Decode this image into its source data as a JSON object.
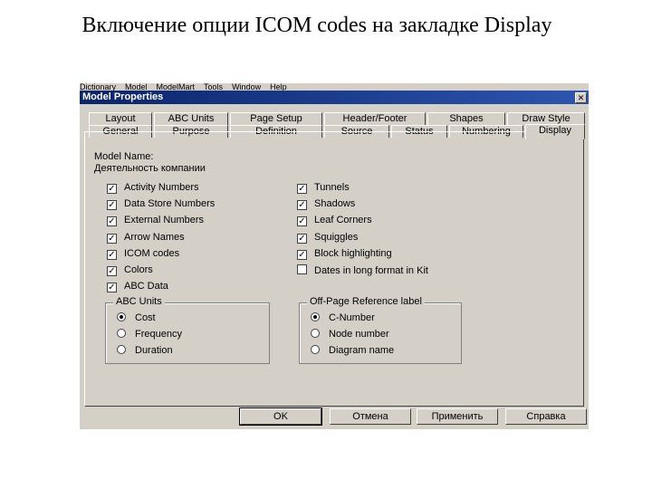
{
  "slide": {
    "title": "Включение опции ICOM codes на закладке Display"
  },
  "menubar": [
    "Dictionary",
    "Model",
    "ModelMart",
    "Tools",
    "Window",
    "Help"
  ],
  "window": {
    "title": "Model Properties",
    "close_glyph": "✕"
  },
  "tabs": {
    "row1": [
      "Layout",
      "ABC Units",
      "Page Setup",
      "Header/Footer",
      "Shapes",
      "Draw Style"
    ],
    "row2": [
      "General",
      "Purpose",
      "Definition",
      "Source",
      "Status",
      "Numbering",
      "Display"
    ],
    "active": "Display"
  },
  "model": {
    "name_label": "Model Name:",
    "name_value": "Деятельность компании"
  },
  "options_left": [
    {
      "label": "Activity Numbers",
      "checked": true
    },
    {
      "label": "Data Store Numbers",
      "checked": true
    },
    {
      "label": "External Numbers",
      "checked": true
    },
    {
      "label": "Arrow Names",
      "checked": true
    },
    {
      "label": "ICOM codes",
      "checked": true
    },
    {
      "label": "Colors",
      "checked": true
    },
    {
      "label": "ABC Data",
      "checked": true
    }
  ],
  "options_right": [
    {
      "label": "Tunnels",
      "checked": true
    },
    {
      "label": "Shadows",
      "checked": true
    },
    {
      "label": "Leaf Corners",
      "checked": true
    },
    {
      "label": "Squiggles",
      "checked": true
    },
    {
      "label": "Block highlighting",
      "checked": true
    },
    {
      "label": "Dates in long format in Kit",
      "checked": false
    }
  ],
  "abc_units": {
    "title": "ABC Units",
    "options": [
      {
        "label": "Cost",
        "selected": true
      },
      {
        "label": "Frequency",
        "selected": false
      },
      {
        "label": "Duration",
        "selected": false
      }
    ]
  },
  "off_page": {
    "title": "Off-Page Reference label",
    "options": [
      {
        "label": "C-Number",
        "selected": true
      },
      {
        "label": "Node number",
        "selected": false
      },
      {
        "label": "Diagram name",
        "selected": false
      }
    ]
  },
  "buttons": {
    "ok": "OK",
    "cancel": "Отмена",
    "apply": "Применить",
    "help": "Справка"
  },
  "check_glyph": "✓"
}
